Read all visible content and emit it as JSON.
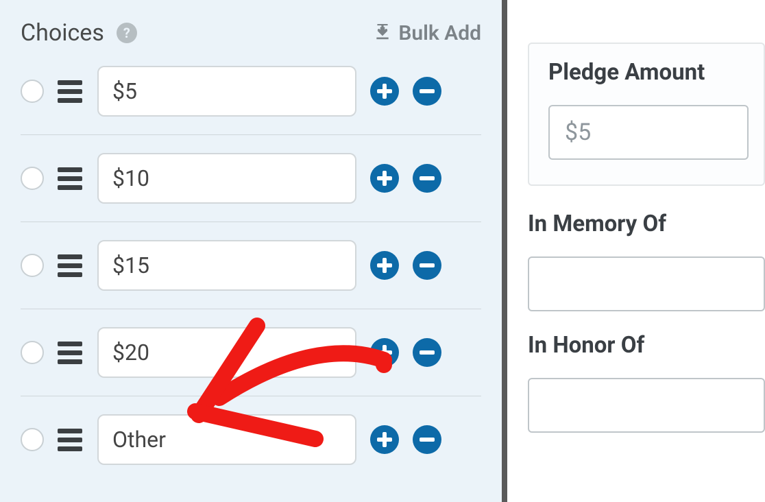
{
  "choices_section": {
    "title": "Choices",
    "bulk_add_label": "Bulk Add"
  },
  "choices": [
    {
      "value": "$5"
    },
    {
      "value": "$10"
    },
    {
      "value": "$15"
    },
    {
      "value": "$20"
    },
    {
      "value": "Other"
    }
  ],
  "preview": {
    "pledge_label": "Pledge Amount",
    "pledge_value": "$5",
    "memory_label": "In Memory Of",
    "honor_label": "In Honor Of"
  }
}
